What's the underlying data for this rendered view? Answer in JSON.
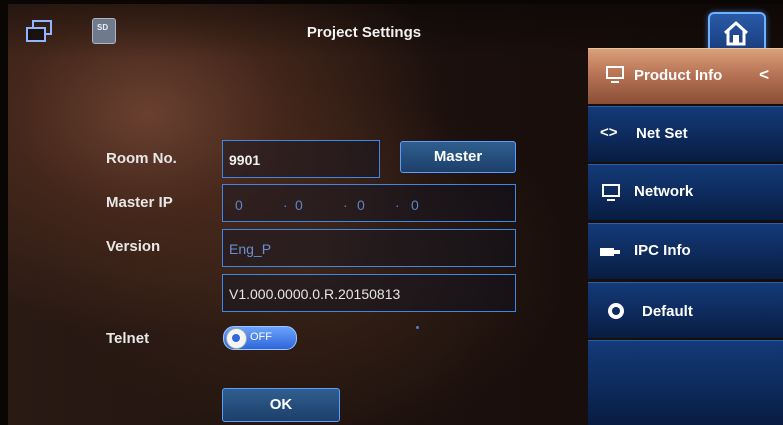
{
  "header": {
    "title": "Project Settings"
  },
  "icons": {
    "window": "multi-window-icon",
    "sd": "sd-card-icon",
    "sd_text": "SD",
    "home": "home-icon"
  },
  "form": {
    "room_label": "Room No.",
    "room_value": "9901",
    "master_button": "Master",
    "master_ip_label": "Master IP",
    "master_ip": [
      "0",
      "0",
      "0",
      "0"
    ],
    "version_label": "Version",
    "version_name": "Eng_P",
    "version_number": "V1.000.0000.0.R.20150813",
    "telnet_label": "Telnet",
    "telnet_state": "OFF",
    "ok_button": "OK"
  },
  "sidebar": {
    "items": [
      {
        "label": "Product Info",
        "icon": "monitor-icon",
        "active": true
      },
      {
        "label": "Net Set",
        "icon": "arrows-icon",
        "glyph": "<>",
        "active": false
      },
      {
        "label": "Network",
        "icon": "network-icon",
        "active": false
      },
      {
        "label": "IPC Info",
        "icon": "ipc-camera-icon",
        "active": false
      },
      {
        "label": "Default",
        "icon": "recycle-icon",
        "active": false
      }
    ],
    "collapse_glyph": "<"
  },
  "colors": {
    "accent_blue": "#3f86e8",
    "active_tab": "#b87456",
    "sidebar_blue": "#0d2a5c"
  }
}
